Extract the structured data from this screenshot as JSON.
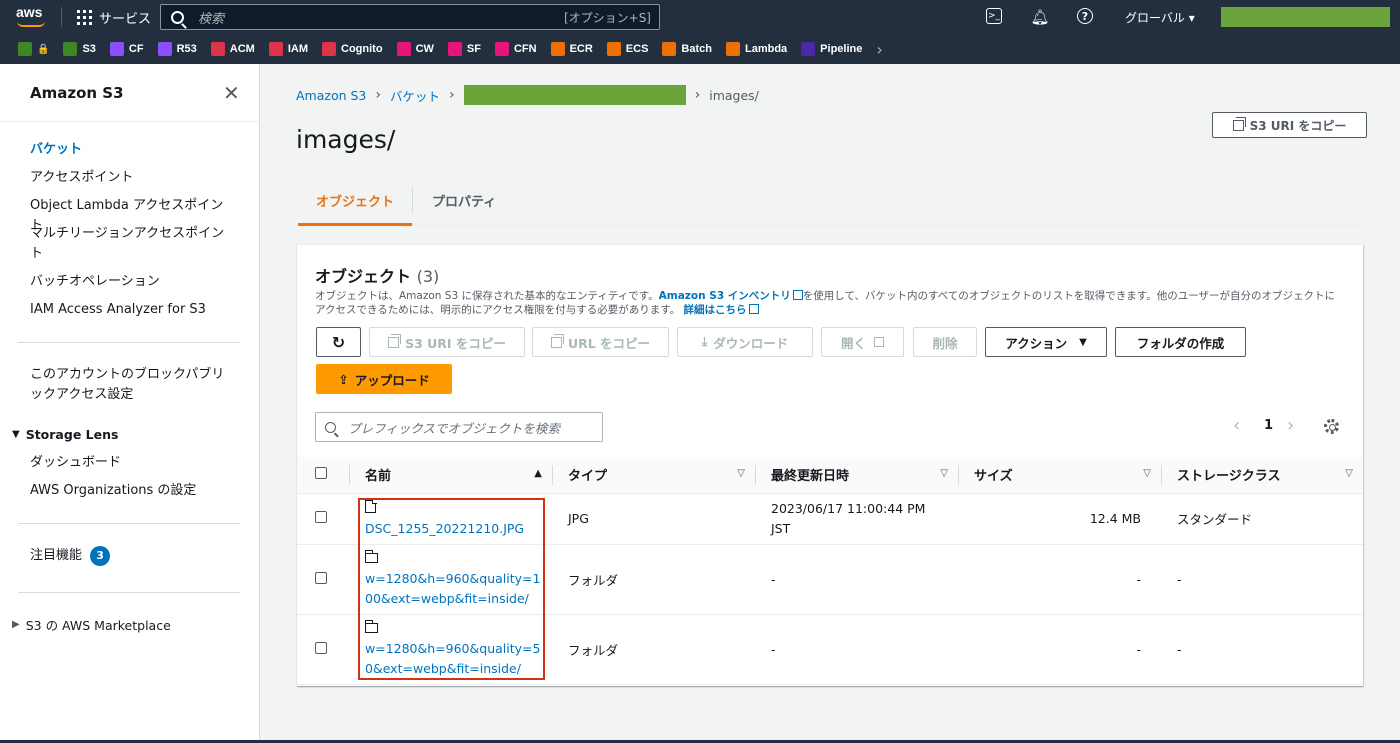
{
  "topnav": {
    "logo": "aws",
    "services": "サービス",
    "search_placeholder": "検索",
    "search_hint": "[オプション+S]",
    "region": "グローバル ▾"
  },
  "favorites": [
    {
      "label": "",
      "color": "#3f8624",
      "icon": "🔒"
    },
    {
      "label": "S3",
      "color": "#3f8624"
    },
    {
      "label": "CF",
      "color": "#8c4fff"
    },
    {
      "label": "R53",
      "color": "#8c4fff"
    },
    {
      "label": "ACM",
      "color": "#dd344c"
    },
    {
      "label": "IAM",
      "color": "#dd344c"
    },
    {
      "label": "Cognito",
      "color": "#dd344c"
    },
    {
      "label": "CW",
      "color": "#e7157b"
    },
    {
      "label": "SF",
      "color": "#e7157b"
    },
    {
      "label": "CFN",
      "color": "#e7157b"
    },
    {
      "label": "ECR",
      "color": "#ed7100"
    },
    {
      "label": "ECS",
      "color": "#ed7100"
    },
    {
      "label": "Batch",
      "color": "#ed7100"
    },
    {
      "label": "Lambda",
      "color": "#ed7100"
    },
    {
      "label": "Pipeline",
      "color": "#4d27aa"
    }
  ],
  "sidebar": {
    "title": "Amazon S3",
    "items": [
      "バケット",
      "アクセスポイント",
      "Object Lambda アクセスポイント",
      "マルチリージョンアクセスポイント",
      "バッチオペレーション",
      "IAM Access Analyzer for S3"
    ],
    "block_public": "このアカウントのブロックパブリックアクセス設定",
    "storage_lens": "Storage Lens",
    "storage_lens_items": [
      "ダッシュボード",
      "AWS Organizations の設定"
    ],
    "featured": "注目機能",
    "featured_count": "3",
    "marketplace": "S3 の AWS Marketplace"
  },
  "breadcrumb": {
    "root": "Amazon S3",
    "buckets": "バケット",
    "current": "images/"
  },
  "page": {
    "title": "images/",
    "copy_uri": "S3 URI をコピー"
  },
  "tabs": {
    "objects": "オブジェクト",
    "properties": "プロパティ"
  },
  "panel": {
    "title": "オブジェクト",
    "count": "(3)",
    "desc_1": "オブジェクトは、Amazon S3 に保存された基本的なエンティティです。",
    "desc_link": "Amazon S3 インベントリ",
    "desc_2": "を使用して、バケット内のすべてのオブジェクトのリストを取得できます。他のユーザーが自分のオブジェクトにアクセスできるためには、明示的にアクセス権限を付与する必要があります。",
    "desc_more": "詳細はこちら"
  },
  "toolbar": {
    "copy_uri": "S3 URI をコピー",
    "copy_url": "URL をコピー",
    "download": "ダウンロード",
    "open": "開く",
    "delete": "削除",
    "actions": "アクション",
    "create_folder": "フォルダの作成",
    "upload": "アップロード"
  },
  "filter_placeholder": "プレフィックスでオブジェクトを検索",
  "pager": {
    "page": "1"
  },
  "table": {
    "headers": [
      "名前",
      "タイプ",
      "最終更新日時",
      "サイズ",
      "ストレージクラス"
    ],
    "rows": [
      {
        "name": "DSC_1255_20221210.JPG",
        "kind": "file",
        "type": "JPG",
        "modified_1": "2023/06/17 11:00:44 PM",
        "modified_2": "JST",
        "size": "12.4 MB",
        "class": "スタンダード"
      },
      {
        "name_1": "w=1280&h=960&quality=1",
        "name_2": "00&ext=webp&fit=inside/",
        "kind": "folder",
        "type": "フォルダ",
        "modified": "-",
        "size": "-",
        "class": "-"
      },
      {
        "name_1": "w=1280&h=960&quality=5",
        "name_2": "0&ext=webp&fit=inside/",
        "kind": "folder",
        "type": "フォルダ",
        "modified": "-",
        "size": "-",
        "class": "-"
      }
    ]
  },
  "colors": {
    "accent": "#ec7211",
    "link": "#0073bb",
    "highlight": "#d13212",
    "redaction": "#6aa43a"
  }
}
